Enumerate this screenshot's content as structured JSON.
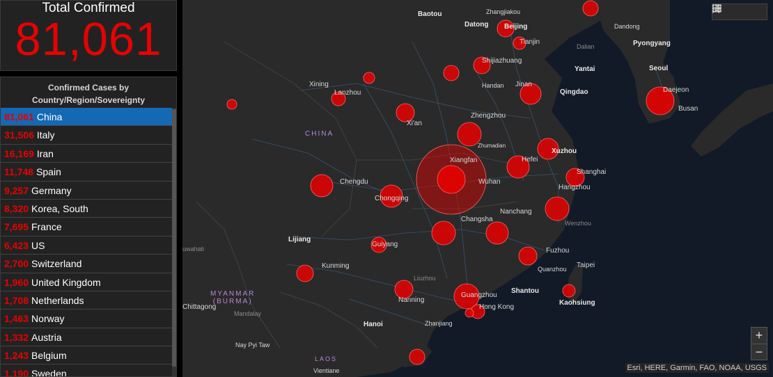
{
  "total": {
    "title": "Total Confirmed",
    "value": "81,061"
  },
  "list": {
    "header_line1": "Confirmed Cases by",
    "header_line2": "Country/Region/Sovereignty",
    "rows": [
      {
        "count": "81,061",
        "name": "China",
        "selected": true
      },
      {
        "count": "31,506",
        "name": "Italy"
      },
      {
        "count": "16,169",
        "name": "Iran"
      },
      {
        "count": "11,748",
        "name": "Spain"
      },
      {
        "count": "9,257",
        "name": "Germany"
      },
      {
        "count": "8,320",
        "name": "Korea, South"
      },
      {
        "count": "7,695",
        "name": "France"
      },
      {
        "count": "6,423",
        "name": "US"
      },
      {
        "count": "2,700",
        "name": "Switzerland"
      },
      {
        "count": "1,960",
        "name": "United Kingdom"
      },
      {
        "count": "1,708",
        "name": "Netherlands"
      },
      {
        "count": "1,463",
        "name": "Norway"
      },
      {
        "count": "1,332",
        "name": "Austria"
      },
      {
        "count": "1,243",
        "name": "Belgium"
      },
      {
        "count": "1,190",
        "name": "Sweden"
      }
    ]
  },
  "map": {
    "labels": {
      "baotou": "Baotou",
      "zhangjiakou": "Zhangjiakou",
      "datong": "Datong",
      "beijing": "Beijing",
      "tianjin": "Tianjin",
      "dandong": "Dandong",
      "pyongyang": "Pyongyang",
      "dalian": "Dalian",
      "shijiazhuang": "Shijiazhuang",
      "yantai": "Yantai",
      "seoul": "Seoul",
      "xining": "Xining",
      "lanzhou": "Lanzhou",
      "handan": "Handan",
      "jinan": "Jinan",
      "qingdao": "Qingdao",
      "daejeon": "Daejeon",
      "busan": "Busan",
      "china": "CHINA",
      "zhengzhou": "Zhengzhou",
      "xian": "Xi'an",
      "zhumadian": "Zhumadian",
      "xuzhou": "Xuzhou",
      "hefei": "Hefei",
      "xiangfan": "Xiangfan",
      "shanghai": "Shanghai",
      "chengdu": "Chengdu",
      "wuhan": "Wuhan",
      "hangzhou": "Hangzhou",
      "chongqing": "Chongqing",
      "nanchang": "Nanchang",
      "wenzhou": "Wenzhou",
      "changsha": "Changsha",
      "lijiang": "Lijiang",
      "guiyang": "Guiyang",
      "fuzhou": "Fuzhou",
      "kunming": "Kunming",
      "taipei": "Taipei",
      "quanzhou": "Quanzhou",
      "myanmar": "MYANMAR",
      "burma": "(BURMA)",
      "liuzhou": "Liuzhou",
      "shantou": "Shantou",
      "guangzhou": "Guangzhou",
      "nanning": "Nanning",
      "hongkong": "Hong Kong",
      "kaohsiung": "Kaohsiung",
      "chittagong": "Chittagong",
      "mandalay": "Mandalay",
      "hanoi": "Hanoi",
      "zhanjiang": "Zhanjiang",
      "naypyitaw": "Nay Pyi Taw",
      "laos": "LAOS",
      "vientiane": "Vientiane",
      "guwahati": "uwahati"
    },
    "attribution": "Esri, HERE, Garmin, FAO, NOAA, USGS",
    "zoom_in": "+",
    "zoom_out": "−"
  },
  "toolbar": {
    "icons": [
      "bookmark-icon",
      "legend-list-icon",
      "basemap-gallery-icon"
    ]
  },
  "colors": {
    "accent_red": "#e60000",
    "selected_row": "#1469b4",
    "panel_bg": "#222222",
    "land": "#2a2a2a",
    "sea": "#111a26",
    "country_label": "#b889d6"
  }
}
